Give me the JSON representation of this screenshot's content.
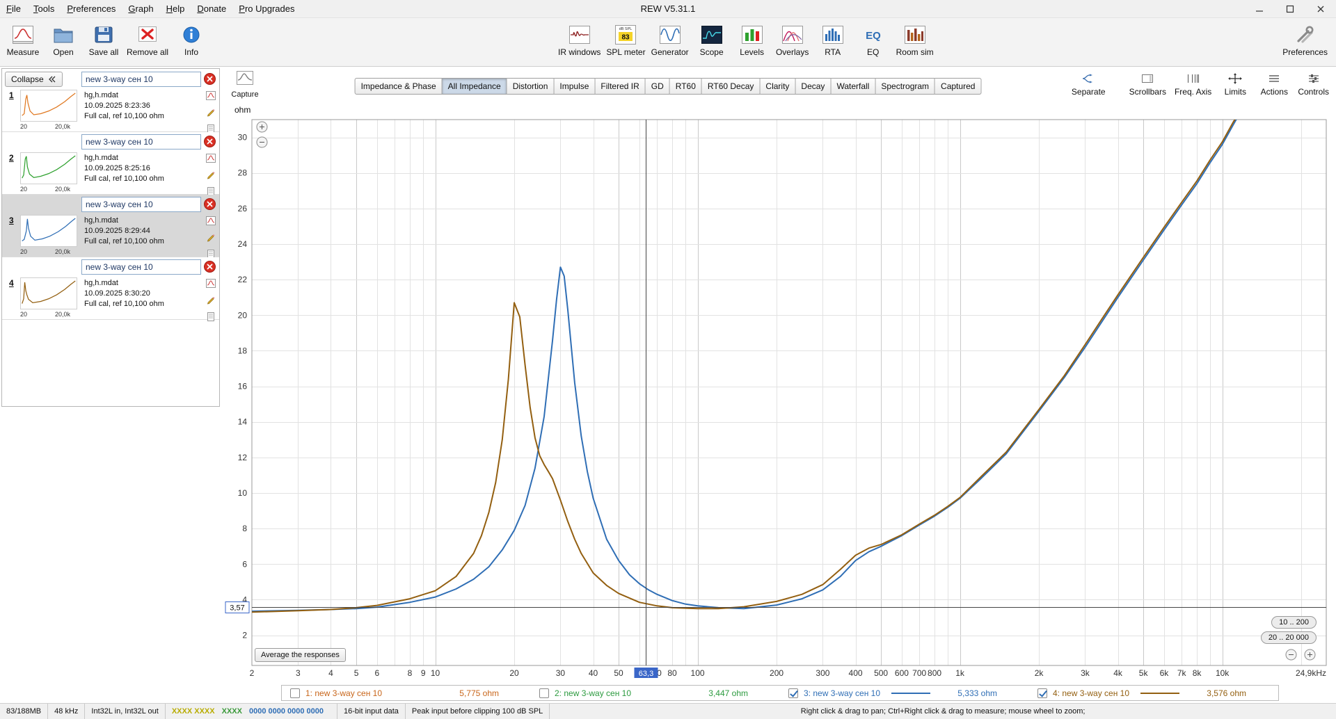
{
  "window": {
    "title": "REW V5.31.1"
  },
  "menu": {
    "items": [
      "File",
      "Tools",
      "Preferences",
      "Graph",
      "Help",
      "Donate",
      "Pro Upgrades"
    ]
  },
  "toolbar": {
    "measure": "Measure",
    "open": "Open",
    "save_all": "Save all",
    "remove_all": "Remove all",
    "info": "Info",
    "ir_windows": "IR windows",
    "spl_meter": "SPL meter",
    "spl_db_label": "dB SPL",
    "spl_value": "83",
    "generator": "Generator",
    "scope": "Scope",
    "levels": "Levels",
    "overlays": "Overlays",
    "rta": "RTA",
    "eq": "EQ",
    "room_sim": "Room sim",
    "preferences": "Preferences"
  },
  "sidebar": {
    "collapse_label": "Collapse",
    "measurements": [
      {
        "num": "1",
        "name": "new 3-way сен 10",
        "file": "hg,h.mdat",
        "date": "10.09.2025 8:23:36",
        "cal": "Full cal, ref 10,100 ohm",
        "axis_min": "20",
        "axis_max": "20,0k",
        "color": "#e07820",
        "selected": false,
        "thumb": [
          [
            0,
            0.13
          ],
          [
            0.04,
            0.2
          ],
          [
            0.07,
            0.75
          ],
          [
            0.09,
            0.9
          ],
          [
            0.11,
            0.6
          ],
          [
            0.15,
            0.3
          ],
          [
            0.22,
            0.16
          ],
          [
            0.35,
            0.2
          ],
          [
            0.5,
            0.3
          ],
          [
            0.65,
            0.45
          ],
          [
            0.8,
            0.65
          ],
          [
            0.92,
            0.85
          ],
          [
            1,
            0.97
          ]
        ]
      },
      {
        "num": "2",
        "name": "new 3-way сен 10",
        "file": "hg,h.mdat",
        "date": "10.09.2025 8:25:16",
        "cal": "Full cal, ref 10,100 ohm",
        "axis_min": "20",
        "axis_max": "20,0k",
        "color": "#2fa12f",
        "selected": false,
        "thumb": [
          [
            0,
            0.13
          ],
          [
            0.03,
            0.25
          ],
          [
            0.06,
            0.85
          ],
          [
            0.08,
            0.95
          ],
          [
            0.1,
            0.55
          ],
          [
            0.14,
            0.28
          ],
          [
            0.22,
            0.15
          ],
          [
            0.35,
            0.2
          ],
          [
            0.5,
            0.3
          ],
          [
            0.65,
            0.45
          ],
          [
            0.8,
            0.65
          ],
          [
            0.92,
            0.85
          ],
          [
            1,
            0.97
          ]
        ]
      },
      {
        "num": "3",
        "name": "new 3-way сен 10",
        "file": "hg,h.mdat",
        "date": "10.09.2025 8:29:44",
        "cal": "Full cal, ref 10,100 ohm",
        "axis_min": "20",
        "axis_max": "20,0k",
        "color": "#2f6eb5",
        "selected": true,
        "thumb": [
          [
            0,
            0.12
          ],
          [
            0.04,
            0.18
          ],
          [
            0.08,
            0.5
          ],
          [
            0.1,
            0.95
          ],
          [
            0.12,
            0.6
          ],
          [
            0.16,
            0.3
          ],
          [
            0.24,
            0.15
          ],
          [
            0.38,
            0.2
          ],
          [
            0.52,
            0.3
          ],
          [
            0.68,
            0.47
          ],
          [
            0.82,
            0.67
          ],
          [
            0.93,
            0.86
          ],
          [
            1,
            0.97
          ]
        ]
      },
      {
        "num": "4",
        "name": "new 3-way сен 10",
        "file": "hg,h.mdat",
        "date": "10.09.2025 8:30:20",
        "cal": "Full cal, ref 10,100 ohm",
        "axis_min": "20",
        "axis_max": "20,0k",
        "color": "#935f10",
        "selected": false,
        "thumb": [
          [
            0,
            0.12
          ],
          [
            0.03,
            0.3
          ],
          [
            0.05,
            0.92
          ],
          [
            0.07,
            0.6
          ],
          [
            0.09,
            0.45
          ],
          [
            0.12,
            0.28
          ],
          [
            0.2,
            0.15
          ],
          [
            0.35,
            0.2
          ],
          [
            0.5,
            0.3
          ],
          [
            0.65,
            0.45
          ],
          [
            0.8,
            0.65
          ],
          [
            0.92,
            0.85
          ],
          [
            1,
            0.97
          ]
        ]
      }
    ]
  },
  "tabs": [
    {
      "label": "Impedance & Phase",
      "active": false
    },
    {
      "label": "All Impedance",
      "active": true
    },
    {
      "label": "Distortion",
      "active": false
    },
    {
      "label": "Impulse",
      "active": false
    },
    {
      "label": "Filtered IR",
      "active": false
    },
    {
      "label": "GD",
      "active": false
    },
    {
      "label": "RT60",
      "active": false
    },
    {
      "label": "RT60 Decay",
      "active": false
    },
    {
      "label": "Clarity",
      "active": false
    },
    {
      "label": "Decay",
      "active": false
    },
    {
      "label": "Waterfall",
      "active": false
    },
    {
      "label": "Spectrogram",
      "active": false
    },
    {
      "label": "Captured",
      "active": false
    }
  ],
  "graph": {
    "capture_label": "Capture",
    "ylabel": "ohm",
    "right_buttons": [
      "Separate",
      "Scrollbars",
      "Freq. Axis",
      "Limits",
      "Actions",
      "Controls"
    ],
    "average_button": "Average the responses",
    "range_buttons": [
      "10 .. 200",
      "20 .. 20 000"
    ]
  },
  "chart_data": {
    "type": "line",
    "title": "All Impedance",
    "ylabel": "ohm",
    "x_unit": "Hz",
    "x_scale": "log",
    "grid": true,
    "xlim": [
      2,
      24900
    ],
    "ylim": [
      0.3,
      31.0
    ],
    "y_ticks": [
      2,
      4,
      6,
      8,
      10,
      12,
      14,
      16,
      18,
      20,
      22,
      24,
      26,
      28,
      30
    ],
    "x_ticks": [
      {
        "v": 2,
        "l": "2"
      },
      {
        "v": 3,
        "l": "3"
      },
      {
        "v": 4,
        "l": "4"
      },
      {
        "v": 5,
        "l": "5"
      },
      {
        "v": 6,
        "l": "6"
      },
      {
        "v": 8,
        "l": "8"
      },
      {
        "v": 9,
        "l": "9"
      },
      {
        "v": 10,
        "l": "10"
      },
      {
        "v": 20,
        "l": "20"
      },
      {
        "v": 30,
        "l": "30"
      },
      {
        "v": 40,
        "l": "40"
      },
      {
        "v": 50,
        "l": "50"
      },
      {
        "v": 70,
        "l": "70"
      },
      {
        "v": 80,
        "l": "80"
      },
      {
        "v": 100,
        "l": "100"
      },
      {
        "v": 200,
        "l": "200"
      },
      {
        "v": 300,
        "l": "300"
      },
      {
        "v": 400,
        "l": "400"
      },
      {
        "v": 500,
        "l": "500"
      },
      {
        "v": 600,
        "l": "600"
      },
      {
        "v": 700,
        "l": "700"
      },
      {
        "v": 800,
        "l": "800"
      },
      {
        "v": 1000,
        "l": "1k"
      },
      {
        "v": 2000,
        "l": "2k"
      },
      {
        "v": 3000,
        "l": "3k"
      },
      {
        "v": 4000,
        "l": "4k"
      },
      {
        "v": 5000,
        "l": "5k"
      },
      {
        "v": 6000,
        "l": "6k"
      },
      {
        "v": 7000,
        "l": "7k"
      },
      {
        "v": 8000,
        "l": "8k"
      },
      {
        "v": 10000,
        "l": "10k"
      },
      {
        "v": 24900,
        "l": "24,9kHz"
      }
    ],
    "cursor": {
      "x": 63.3,
      "x_label": "63,3",
      "y": 3.57,
      "y_label": "3,57"
    },
    "series": [
      {
        "name": "3: new 3-way сен 10",
        "color": "#2f6eb5",
        "points": [
          [
            2,
            3.35
          ],
          [
            3,
            3.4
          ],
          [
            4,
            3.45
          ],
          [
            5,
            3.5
          ],
          [
            6,
            3.58
          ],
          [
            8,
            3.85
          ],
          [
            10,
            4.15
          ],
          [
            12,
            4.6
          ],
          [
            14,
            5.15
          ],
          [
            16,
            5.85
          ],
          [
            18,
            6.8
          ],
          [
            20,
            7.9
          ],
          [
            22,
            9.3
          ],
          [
            24,
            11.4
          ],
          [
            26,
            14.3
          ],
          [
            28,
            18.6
          ],
          [
            29,
            20.9
          ],
          [
            30,
            22.7
          ],
          [
            31,
            22.2
          ],
          [
            32,
            20.3
          ],
          [
            34,
            16.2
          ],
          [
            36,
            13.2
          ],
          [
            38,
            11.2
          ],
          [
            40,
            9.7
          ],
          [
            45,
            7.4
          ],
          [
            50,
            6.2
          ],
          [
            55,
            5.4
          ],
          [
            60,
            4.9
          ],
          [
            65,
            4.55
          ],
          [
            70,
            4.3
          ],
          [
            80,
            3.95
          ],
          [
            90,
            3.75
          ],
          [
            100,
            3.65
          ],
          [
            120,
            3.55
          ],
          [
            150,
            3.5
          ],
          [
            200,
            3.7
          ],
          [
            250,
            4.05
          ],
          [
            300,
            4.55
          ],
          [
            350,
            5.3
          ],
          [
            400,
            6.2
          ],
          [
            450,
            6.7
          ],
          [
            500,
            7.0
          ],
          [
            600,
            7.6
          ],
          [
            700,
            8.2
          ],
          [
            800,
            8.7
          ],
          [
            900,
            9.2
          ],
          [
            1000,
            9.7
          ],
          [
            1200,
            10.8
          ],
          [
            1500,
            12.2
          ],
          [
            2000,
            14.6
          ],
          [
            2500,
            16.5
          ],
          [
            3000,
            18.2
          ],
          [
            3500,
            19.7
          ],
          [
            4000,
            21.0
          ],
          [
            5000,
            23.1
          ],
          [
            6000,
            24.8
          ],
          [
            7000,
            26.2
          ],
          [
            8000,
            27.4
          ],
          [
            9000,
            28.6
          ],
          [
            10000,
            29.6
          ],
          [
            11000,
            30.7
          ],
          [
            11600,
            31.3
          ]
        ]
      },
      {
        "name": "4: new 3-way сен 10",
        "color": "#935f10",
        "points": [
          [
            2,
            3.3
          ],
          [
            3,
            3.38
          ],
          [
            4,
            3.45
          ],
          [
            5,
            3.55
          ],
          [
            6,
            3.68
          ],
          [
            8,
            4.05
          ],
          [
            10,
            4.5
          ],
          [
            12,
            5.3
          ],
          [
            14,
            6.6
          ],
          [
            15,
            7.6
          ],
          [
            16,
            8.9
          ],
          [
            17,
            10.6
          ],
          [
            18,
            13.0
          ],
          [
            19,
            16.4
          ],
          [
            20,
            20.7
          ],
          [
            21,
            19.9
          ],
          [
            22,
            17.2
          ],
          [
            23,
            14.8
          ],
          [
            24,
            13.1
          ],
          [
            25,
            12.1
          ],
          [
            26,
            11.6
          ],
          [
            27,
            11.2
          ],
          [
            28,
            10.8
          ],
          [
            30,
            9.6
          ],
          [
            32,
            8.4
          ],
          [
            34,
            7.4
          ],
          [
            36,
            6.6
          ],
          [
            40,
            5.5
          ],
          [
            45,
            4.8
          ],
          [
            50,
            4.35
          ],
          [
            60,
            3.85
          ],
          [
            70,
            3.65
          ],
          [
            80,
            3.55
          ],
          [
            100,
            3.5
          ],
          [
            120,
            3.5
          ],
          [
            150,
            3.6
          ],
          [
            200,
            3.9
          ],
          [
            250,
            4.3
          ],
          [
            300,
            4.85
          ],
          [
            350,
            5.7
          ],
          [
            400,
            6.5
          ],
          [
            450,
            6.9
          ],
          [
            500,
            7.1
          ],
          [
            600,
            7.65
          ],
          [
            700,
            8.25
          ],
          [
            800,
            8.75
          ],
          [
            900,
            9.25
          ],
          [
            1000,
            9.75
          ],
          [
            1200,
            10.9
          ],
          [
            1500,
            12.3
          ],
          [
            2000,
            14.7
          ],
          [
            2500,
            16.6
          ],
          [
            3000,
            18.35
          ],
          [
            3500,
            19.85
          ],
          [
            4000,
            21.15
          ],
          [
            5000,
            23.25
          ],
          [
            6000,
            24.95
          ],
          [
            7000,
            26.35
          ],
          [
            8000,
            27.55
          ],
          [
            9000,
            28.75
          ],
          [
            10000,
            29.75
          ],
          [
            11000,
            30.85
          ],
          [
            11500,
            31.3
          ]
        ]
      }
    ]
  },
  "legend": {
    "items": [
      {
        "label": "1: new 3-way сен 10",
        "value": "5,775 ohm",
        "color": "#c8661b",
        "checked": false,
        "line_sample": false
      },
      {
        "label": "2: new 3-way сен 10",
        "value": "3,447 ohm",
        "color": "#2b9a3e",
        "checked": false,
        "line_sample": false
      },
      {
        "label": "3: new 3-way сен 10",
        "value": "5,333 ohm",
        "color": "#2f6eb5",
        "checked": true,
        "line_sample": true
      },
      {
        "label": "4: new 3-way сен 10",
        "value": "3,576 ohm",
        "color": "#935f10",
        "checked": true,
        "line_sample": true
      }
    ]
  },
  "statusbar": {
    "memory": "83/188MB",
    "sample_rate": "48 kHz",
    "io_format": "Int32L in, Int32L out",
    "bits_a": "XXXX XXXX",
    "bits_b": "XXXX",
    "bits_c": "0000 0000 0000 0000",
    "colors": {
      "bits_a": "#b8ac00",
      "bits_b": "#3a9a3a",
      "bits_c": "#2f6eb5"
    },
    "input_data": "16-bit input data",
    "peak": "Peak input before clipping 100 dB SPL",
    "hint": "Right click & drag to pan; Ctrl+Right click & drag to measure; mouse wheel to zoom;"
  }
}
